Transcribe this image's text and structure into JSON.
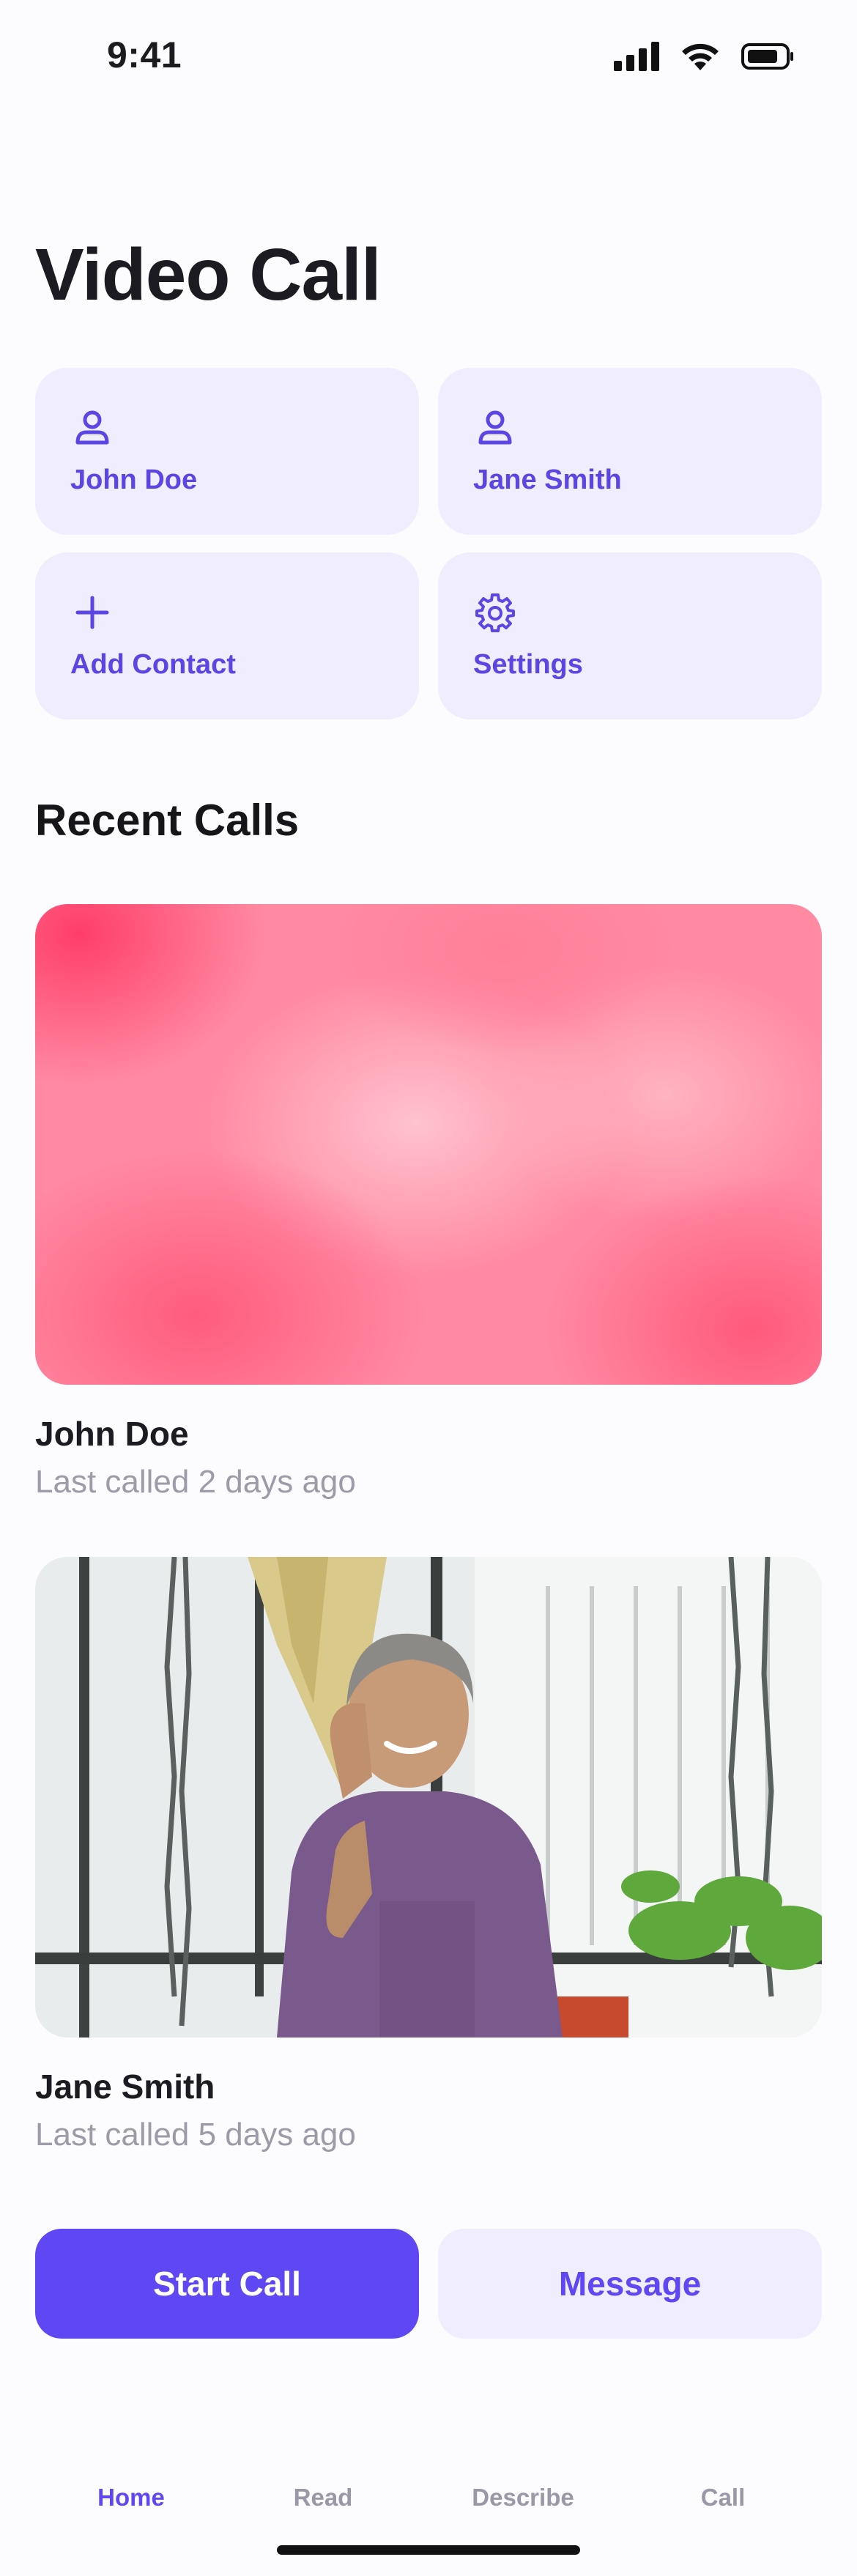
{
  "status_bar": {
    "time": "9:41"
  },
  "page": {
    "title": "Video Call"
  },
  "tiles": [
    {
      "label": "John Doe",
      "icon": "person-icon"
    },
    {
      "label": "Jane Smith",
      "icon": "person-icon"
    },
    {
      "label": "Add Contact",
      "icon": "plus-icon"
    },
    {
      "label": "Settings",
      "icon": "gear-icon"
    }
  ],
  "recent_calls": {
    "title": "Recent Calls",
    "items": [
      {
        "name": "John Doe",
        "subtitle": "Last called 2 days ago",
        "photo": "pink clouds"
      },
      {
        "name": "Jane Smith",
        "subtitle": "Last called 5 days ago",
        "photo": "woman on phone"
      }
    ]
  },
  "actions": {
    "primary": "Start Call",
    "secondary": "Message"
  },
  "tab_bar": {
    "tabs": [
      {
        "label": "Home",
        "active": true
      },
      {
        "label": "Read",
        "active": false
      },
      {
        "label": "Describe",
        "active": false
      },
      {
        "label": "Call",
        "active": false
      }
    ]
  },
  "colors": {
    "accent": "#5f48f4",
    "tile_bg": "#efedfe",
    "muted_text": "#9d9ba8"
  }
}
